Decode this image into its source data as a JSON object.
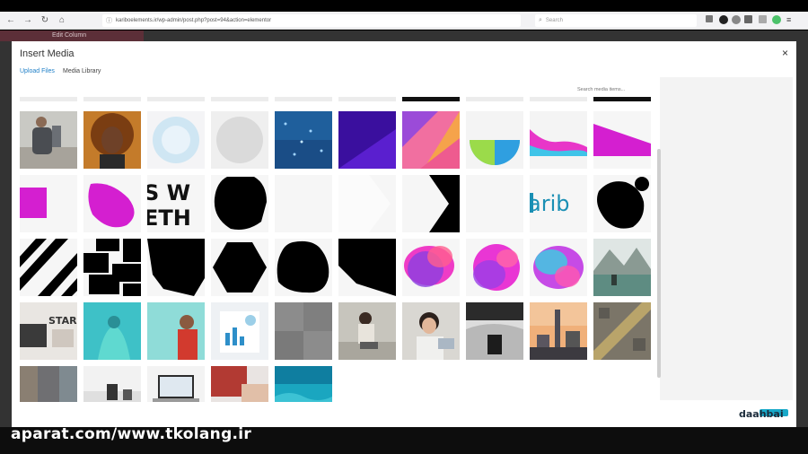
{
  "browser": {
    "url": "kariboelements.ir/wp-admin/post.php?post=94&action=elementor",
    "search_placeholder": "Search"
  },
  "editor": {
    "panel_title": "Edit Column"
  },
  "modal": {
    "title": "Insert Media",
    "close": "×",
    "tabs": [
      {
        "label": "Upload Files",
        "active": true
      },
      {
        "label": "Media Library",
        "active": false
      }
    ],
    "search_placeholder": "Search media items..."
  },
  "watermark": "aparat.com/www.tkolang.ir",
  "logo": "daahbai",
  "colors": {
    "accent": "#1e7fc7",
    "magenta": "#e81fd9",
    "purple": "#5a1fcf",
    "blue": "#2d6fdc"
  },
  "media_items": [
    {
      "kind": "photo-man",
      "row": 0,
      "col": 0
    },
    {
      "kind": "photo-woman-curly",
      "row": 0,
      "col": 1
    },
    {
      "kind": "blur-circle-light",
      "row": 0,
      "col": 2
    },
    {
      "kind": "blur-circle-grey",
      "row": 0,
      "col": 3
    },
    {
      "kind": "photo-blue-particles",
      "row": 0,
      "col": 4
    },
    {
      "kind": "photo-purple",
      "row": 0,
      "col": 5
    },
    {
      "kind": "photo-geometric-colorful",
      "row": 0,
      "col": 6
    },
    {
      "kind": "gradient-half-circle",
      "row": 0,
      "col": 7
    },
    {
      "kind": "gradient-wave",
      "row": 0,
      "col": 8
    },
    {
      "kind": "magenta-slant",
      "row": 0,
      "col": 9
    },
    {
      "kind": "magenta-square",
      "row": 1,
      "col": 0
    },
    {
      "kind": "magenta-blob",
      "row": 1,
      "col": 1
    },
    {
      "kind": "text-swe",
      "row": 1,
      "col": 2
    },
    {
      "kind": "black-octagon-blob",
      "row": 1,
      "col": 3
    },
    {
      "kind": "blank-light",
      "row": 1,
      "col": 4
    },
    {
      "kind": "white-arrow",
      "row": 1,
      "col": 5
    },
    {
      "kind": "black-arrow",
      "row": 1,
      "col": 6
    },
    {
      "kind": "blank-light",
      "row": 1,
      "col": 7
    },
    {
      "kind": "text-karib",
      "row": 1,
      "col": 8
    },
    {
      "kind": "black-blob-dot",
      "row": 1,
      "col": 9
    },
    {
      "kind": "black-stripes",
      "row": 2,
      "col": 0
    },
    {
      "kind": "black-rect-cluster",
      "row": 2,
      "col": 1
    },
    {
      "kind": "black-polygon",
      "row": 2,
      "col": 2
    },
    {
      "kind": "black-hexagon",
      "row": 2,
      "col": 3
    },
    {
      "kind": "black-rounded-blob",
      "row": 2,
      "col": 4
    },
    {
      "kind": "black-trapezoid",
      "row": 2,
      "col": 5
    },
    {
      "kind": "gradient-blob-1",
      "row": 2,
      "col": 6
    },
    {
      "kind": "gradient-blob-2",
      "row": 2,
      "col": 7
    },
    {
      "kind": "gradient-blob-3",
      "row": 2,
      "col": 8
    },
    {
      "kind": "photo-mountain-lake",
      "row": 2,
      "col": 9
    },
    {
      "kind": "photo-desk-start",
      "row": 3,
      "col": 0
    },
    {
      "kind": "photo-teal-figure",
      "row": 3,
      "col": 1
    },
    {
      "kind": "photo-man-red",
      "row": 3,
      "col": 2
    },
    {
      "kind": "photo-charts-paper",
      "row": 3,
      "col": 3
    },
    {
      "kind": "photo-grey-texture",
      "row": 3,
      "col": 4
    },
    {
      "kind": "photo-woman-sitting",
      "row": 3,
      "col": 5
    },
    {
      "kind": "photo-woman-glasses",
      "row": 3,
      "col": 6
    },
    {
      "kind": "photo-car-interior",
      "row": 3,
      "col": 7
    },
    {
      "kind": "photo-city-sunset",
      "row": 3,
      "col": 8
    },
    {
      "kind": "photo-aerial-city",
      "row": 3,
      "col": 9
    },
    {
      "kind": "photo-street",
      "row": 4,
      "col": 0
    },
    {
      "kind": "photo-office",
      "row": 4,
      "col": 1
    },
    {
      "kind": "photo-laptop",
      "row": 4,
      "col": 2
    },
    {
      "kind": "photo-red-hands",
      "row": 4,
      "col": 3
    },
    {
      "kind": "photo-teal-water",
      "row": 4,
      "col": 4
    }
  ]
}
